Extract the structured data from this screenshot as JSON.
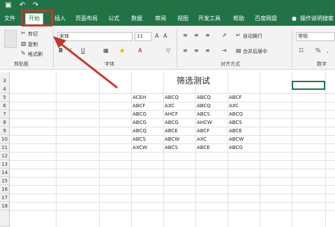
{
  "colors": {
    "brand": "#217346",
    "annotation": "#c0392b"
  },
  "titlebar": {
    "icons": [
      "save-icon",
      "undo-icon",
      "redo-icon"
    ]
  },
  "tabs": [
    {
      "label": "文件"
    },
    {
      "label": "开始",
      "active": true
    },
    {
      "label": "插入"
    },
    {
      "label": "页面布局"
    },
    {
      "label": "公式"
    },
    {
      "label": "数据"
    },
    {
      "label": "审阅"
    },
    {
      "label": "视图"
    },
    {
      "label": "开发工具"
    },
    {
      "label": "帮助"
    },
    {
      "label": "百度网盘"
    },
    {
      "label": "操作说明搜索"
    }
  ],
  "ribbon": {
    "clipboard": {
      "cut": "剪切",
      "copy": "复制",
      "format_painter": "格式刷",
      "label": "剪贴板"
    },
    "font": {
      "font_name": "宋体",
      "font_size": "11",
      "label": "字体"
    },
    "alignment": {
      "wrap": "自动换行",
      "merge": "合并后居中",
      "label": "对齐方式"
    },
    "number": {
      "format": "常规",
      "label": "数字"
    }
  },
  "sheet": {
    "title": "筛选测试",
    "rows": [
      "3",
      "4",
      "5",
      "6",
      "7",
      "8",
      "9",
      "10",
      "11",
      "12",
      "13",
      "14",
      "15",
      "16",
      "17",
      "18"
    ],
    "table": [
      [
        "ACEH",
        "ABCQ",
        "ABCQ",
        "ABCF"
      ],
      [
        "ABCF",
        "AXC",
        "ABCQ",
        "AXC"
      ],
      [
        "ABCG",
        "AHCF",
        "ABCS",
        "ABCQ"
      ],
      [
        "ABCG",
        "ABCG",
        "AHCW",
        "ABCS"
      ],
      [
        "ABCQ",
        "ABCE",
        "ABCF",
        "ABCE"
      ],
      [
        "ABCS",
        "ABCW",
        "AXC",
        "ABCW"
      ],
      [
        "AXCW",
        "ABCS",
        "ABCE",
        "ABCG"
      ]
    ]
  }
}
